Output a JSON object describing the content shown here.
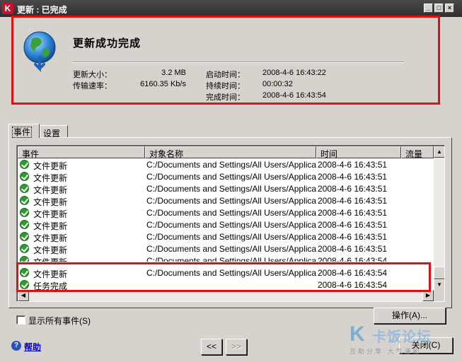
{
  "window": {
    "title": "更新 : 已完成",
    "controls": [
      "_",
      "□",
      "×"
    ]
  },
  "summary": {
    "heading": "更新成功完成",
    "update_size_label": "更新大小：",
    "update_size_value": "3.2 MB",
    "transfer_speed_label": "传输速率：",
    "transfer_speed_value": "6160.35 Kb/s",
    "start_time_label": "启动时间：",
    "start_time_value": "2008-4-6 16:43:22",
    "duration_label": "持续时间：",
    "duration_value": "00:00:32",
    "finish_time_label": "完成时间：",
    "finish_time_value": "2008-4-6 16:43:54"
  },
  "tabs": [
    {
      "label": "事件"
    },
    {
      "label": "设置"
    }
  ],
  "table": {
    "columns": [
      "事件",
      "对象名称",
      "时间",
      "流量"
    ],
    "rows": [
      {
        "event": "文件更新",
        "object": "C:/Documents and Settings/All Users/Applicatio...",
        "time": "2008-4-6 16:43:51"
      },
      {
        "event": "文件更新",
        "object": "C:/Documents and Settings/All Users/Applicatio...",
        "time": "2008-4-6 16:43:51"
      },
      {
        "event": "文件更新",
        "object": "C:/Documents and Settings/All Users/Applicatio...",
        "time": "2008-4-6 16:43:51"
      },
      {
        "event": "文件更新",
        "object": "C:/Documents and Settings/All Users/Applicatio...",
        "time": "2008-4-6 16:43:51"
      },
      {
        "event": "文件更新",
        "object": "C:/Documents and Settings/All Users/Applicatio...",
        "time": "2008-4-6 16:43:51"
      },
      {
        "event": "文件更新",
        "object": "C:/Documents and Settings/All Users/Applicatio...",
        "time": "2008-4-6 16:43:51"
      },
      {
        "event": "文件更新",
        "object": "C:/Documents and Settings/All Users/Applicatio...",
        "time": "2008-4-6 16:43:51"
      },
      {
        "event": "文件更新",
        "object": "C:/Documents and Settings/All Users/Applicatio...",
        "time": "2008-4-6 16:43:51"
      },
      {
        "event": "文件更新",
        "object": "C:/Documents and Settings/All Users/Applicatio...",
        "time": "2008-4-6 16:43:54"
      },
      {
        "event": "文件更新",
        "object": "C:/Documents and Settings/All Users/Applicatio...",
        "time": "2008-4-6 16:43:54"
      },
      {
        "event": "任务完成",
        "object": "",
        "time": "2008-4-6 16:43:54"
      }
    ]
  },
  "buttons": {
    "actions": "操作(A)...",
    "prev": "<<",
    "next": ">>",
    "close": "关闭(C)"
  },
  "show_all_events": {
    "label": "显示所有事件(S)",
    "checked": false
  },
  "help": {
    "label": "帮助"
  },
  "watermark": {
    "brand": "卡饭论坛",
    "tagline": "互助分享 大气谦和"
  },
  "colors": {
    "highlight_border": "#dd1111",
    "success_icon": "#2e9b2e"
  }
}
